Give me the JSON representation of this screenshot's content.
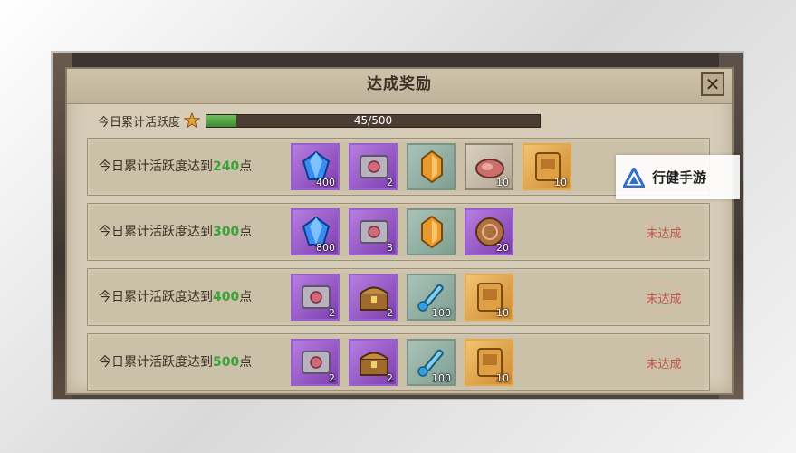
{
  "panel": {
    "title": "达成奖励",
    "close_label": "✕"
  },
  "activity": {
    "label": "今日累计活跃度",
    "current": 45,
    "max": 500,
    "text": "45/500",
    "fill_fraction": 0.09
  },
  "rows": [
    {
      "prefix": "今日累计活跃度达到",
      "target": "240",
      "suffix": "点",
      "status": "",
      "items": [
        {
          "icon": "blue-gem-icon",
          "color": "purple",
          "qty": "400"
        },
        {
          "icon": "skill-card-icon",
          "color": "purple",
          "qty": "2"
        },
        {
          "icon": "amber-crystal-icon",
          "color": "green",
          "qty": ""
        },
        {
          "icon": "meat-icon",
          "color": "gray",
          "qty": "10"
        },
        {
          "icon": "gold-card-icon",
          "color": "gold",
          "qty": "10"
        }
      ]
    },
    {
      "prefix": "今日累计活跃度达到",
      "target": "300",
      "suffix": "点",
      "status": "未达成",
      "items": [
        {
          "icon": "blue-gem-icon",
          "color": "purple",
          "qty": "800"
        },
        {
          "icon": "skill-card-icon",
          "color": "purple",
          "qty": "3"
        },
        {
          "icon": "amber-crystal-icon",
          "color": "green",
          "qty": ""
        },
        {
          "icon": "bronze-medal-icon",
          "color": "purple",
          "qty": "20"
        }
      ]
    },
    {
      "prefix": "今日累计活跃度达到",
      "target": "400",
      "suffix": "点",
      "status": "未达成",
      "items": [
        {
          "icon": "skill-card-icon",
          "color": "purple",
          "qty": "2"
        },
        {
          "icon": "treasure-chest-icon",
          "color": "purple",
          "qty": "2"
        },
        {
          "icon": "potion-syringe-icon",
          "color": "green",
          "qty": "100"
        },
        {
          "icon": "gold-card-icon",
          "color": "gold",
          "qty": "10"
        }
      ]
    },
    {
      "prefix": "今日累计活跃度达到",
      "target": "500",
      "suffix": "点",
      "status": "未达成",
      "items": [
        {
          "icon": "skill-card-icon",
          "color": "purple",
          "qty": "2"
        },
        {
          "icon": "treasure-chest-icon",
          "color": "purple",
          "qty": "2"
        },
        {
          "icon": "potion-syringe-icon",
          "color": "green",
          "qty": "100"
        },
        {
          "icon": "gold-card-icon",
          "color": "gold",
          "qty": "10"
        }
      ]
    }
  ],
  "watermark": {
    "text": "行健手游"
  },
  "colors": {
    "target_number": "#3aa33a",
    "status_text": "#c0574a",
    "progress_fill": "#4f9e41"
  }
}
